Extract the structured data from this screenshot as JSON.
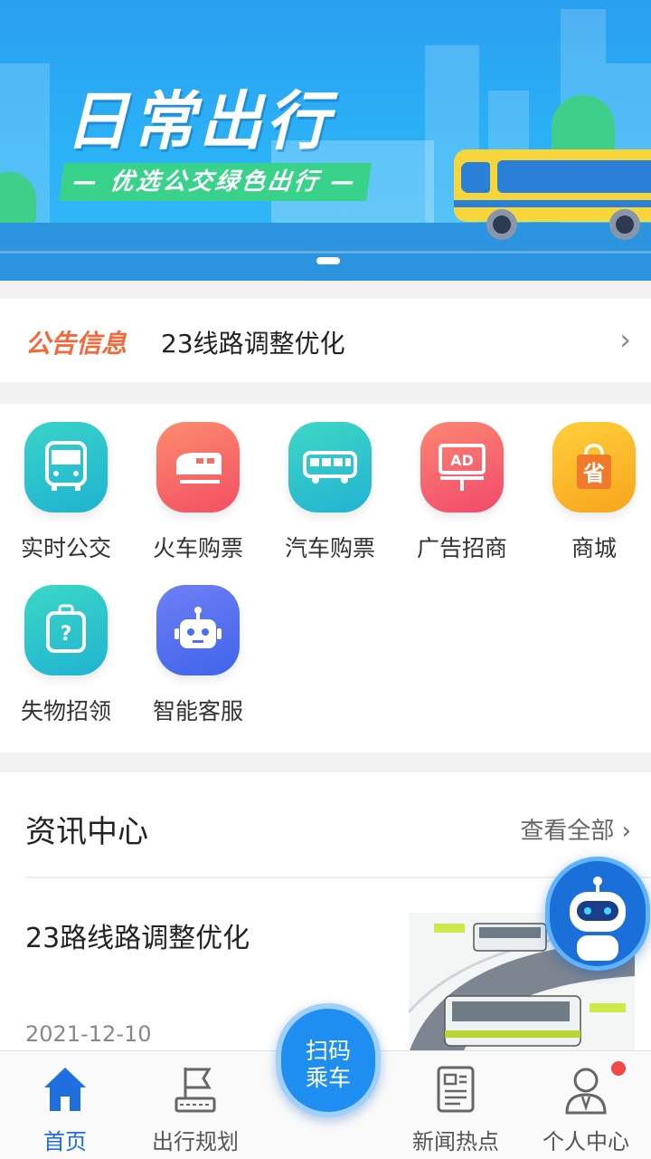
{
  "banner": {
    "title": "日常出行",
    "subtitle": "— 优选公交绿色出行 —"
  },
  "notice": {
    "tag": "公告信息",
    "text": "23线路调整优化",
    "arrow": "›"
  },
  "services": [
    {
      "label": "实时公交",
      "icon": "bus-front-icon",
      "color": "#26c2c9"
    },
    {
      "label": "火车购票",
      "icon": "train-icon",
      "color": "#f66b5e"
    },
    {
      "label": "汽车购票",
      "icon": "coach-bus-icon",
      "color": "#2ec6c4"
    },
    {
      "label": "广告招商",
      "icon": "ad-billboard-icon",
      "color": "#f7606b"
    },
    {
      "label": "商城",
      "icon": "shopping-bag-icon",
      "color": "#f7b523"
    },
    {
      "label": "失物招领",
      "icon": "luggage-icon",
      "color": "#2bc5c7"
    },
    {
      "label": "智能客服",
      "icon": "robot-icon",
      "color": "#4a6ff0"
    }
  ],
  "news": {
    "section_title": "资讯中心",
    "view_all": "查看全部 ›",
    "item": {
      "title": "23路线路调整优化",
      "date": "2021-12-10"
    }
  },
  "tabbar": {
    "items": [
      {
        "label": "首页",
        "icon": "home-icon",
        "active": true
      },
      {
        "label": "出行规划",
        "icon": "flag-route-icon",
        "active": false
      },
      {
        "label": "新闻热点",
        "icon": "newspaper-icon",
        "active": false
      },
      {
        "label": "个人中心",
        "icon": "user-icon",
        "active": false
      }
    ],
    "scan_line1": "扫码",
    "scan_line2": "乘车"
  },
  "colors": {
    "accent": "#1e6ee0",
    "notice_tag": "#f26a3b",
    "badge": "#f04848"
  }
}
